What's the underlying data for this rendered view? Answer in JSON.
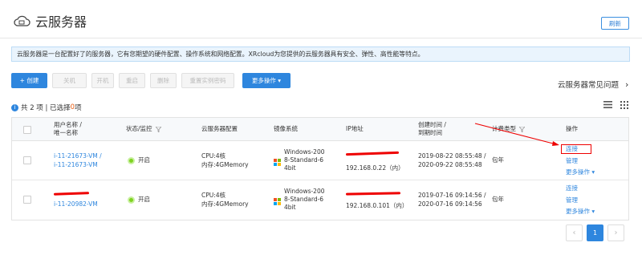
{
  "header": {
    "title": "云服务器",
    "icon": "cloud-server-icon",
    "refresh_label": "刷新"
  },
  "info": {
    "text": "云服务器是一台配置好了的服务器，它有您期望的硬件配置、操作系统和网络配置。XRcloud为您提供的云服务器具有安全、弹性、高性能等特点。"
  },
  "toolbar": {
    "create_label": "+ 创建",
    "shutdown_label": "关机",
    "start_label": "开机",
    "restart_label": "重启",
    "delete_label": "删除",
    "reset_password_label": "重置实例密码",
    "more_label": "更多操作 ▾"
  },
  "faq": {
    "label": "云服务器常见问题"
  },
  "summary": {
    "count_badge": "i",
    "prefix": "共 2 项 | 已选择 ",
    "selected": "0",
    "suffix": "项"
  },
  "table": {
    "headers": {
      "name_line1": "用户名称 /",
      "name_line2": "唯一名称",
      "status": "状态/监控",
      "config": "云服务器配置",
      "image": "镜像系统",
      "ip": "IP地址",
      "time_line1": "创建时间 /",
      "time_line2": "到期时间",
      "billing": "计费类型",
      "actions": "操作"
    },
    "rows": [
      {
        "name_line1": "i-11-21673-VM /",
        "name_line2": "i-11-21673-VM",
        "status": "开启",
        "cpu": "CPU:4核",
        "mem": "内存:4GMemory",
        "image_line1": "Windows-200",
        "image_line2": "8-Standard-6",
        "image_line3": "4bit",
        "ip": "192.168.0.22（内）",
        "created": "2019-08-22 08:55:48 /",
        "expires": "2020-09-22 08:55:48",
        "billing": "包年",
        "action_connect": "连接",
        "action_manage": "管理",
        "action_more": "更多操作 ▾"
      },
      {
        "name_line2": "i-11-20982-VM",
        "status": "开启",
        "cpu": "CPU:4核",
        "mem": "内存:4GMemory",
        "image_line1": "Windows-200",
        "image_line2": "8-Standard-6",
        "image_line3": "4bit",
        "ip": "192.168.0.101（内）",
        "created": "2019-07-16 09:14:56 /",
        "expires": "2020-07-16 09:14:56",
        "billing": "包年",
        "action_connect": "连接",
        "action_manage": "管理",
        "action_more": "更多操作 ▾"
      }
    ]
  },
  "pagination": {
    "prev": "‹",
    "current": "1",
    "next": "›"
  },
  "colors": {
    "primary": "#2e86de",
    "annotation_red": "#e00000",
    "status_green": "#7ed321",
    "info_bg": "#eaf4fd"
  }
}
